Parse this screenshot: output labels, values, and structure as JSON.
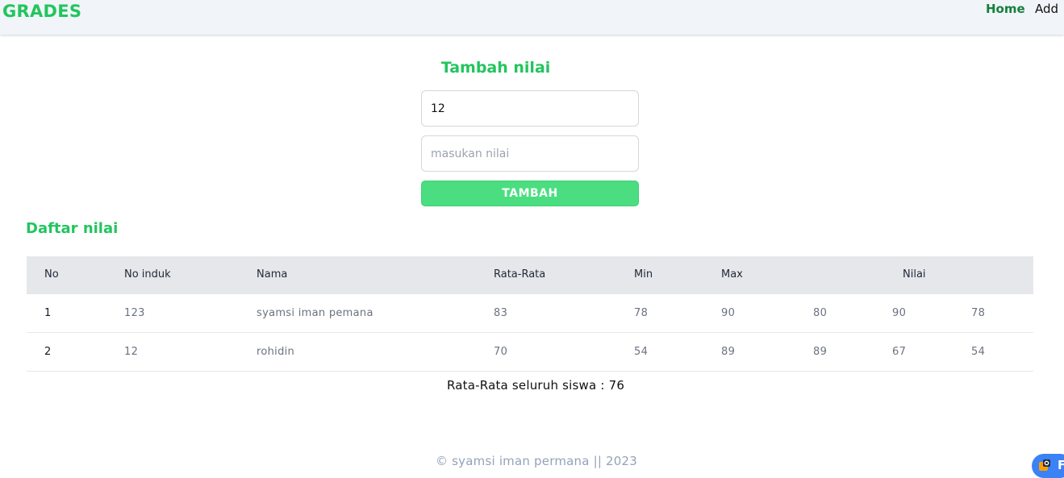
{
  "navbar": {
    "brand": "GRADES",
    "links": [
      {
        "label": "Home"
      },
      {
        "label": "Add"
      }
    ]
  },
  "form": {
    "title": "Tambah nilai",
    "field1_value": "12",
    "field2_placeholder": "masukan nilai",
    "submit_label": "TAMBAH"
  },
  "list": {
    "title": "Daftar nilai",
    "headers": {
      "no": "No",
      "no_induk": "No induk",
      "nama": "Nama",
      "rata": "Rata-Rata",
      "min": "Min",
      "max": "Max",
      "nilai": "Nilai"
    },
    "rows": [
      {
        "no": "1",
        "no_induk": "123",
        "nama": "syamsi iman pemana",
        "rata": "83",
        "min": "78",
        "max": "90",
        "nilai": [
          "80",
          "90",
          "78"
        ]
      },
      {
        "no": "2",
        "no_induk": "12",
        "nama": "rohidin",
        "rata": "70",
        "min": "54",
        "max": "89",
        "nilai": [
          "89",
          "67",
          "54"
        ]
      }
    ]
  },
  "summary": "Rata-Rata seluruh siswa : 76",
  "footer": "© syamsi iman permana || 2023",
  "widget": {
    "letter": "F",
    "icon": "extension-icon",
    "color": "#3b82f6"
  },
  "colors": {
    "accent": "#22c55e",
    "button": "#4ade80",
    "home_link": "#15803d"
  }
}
